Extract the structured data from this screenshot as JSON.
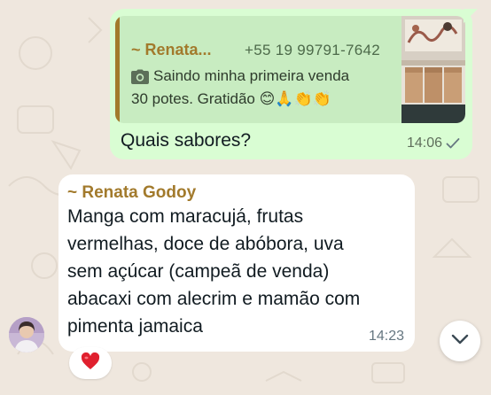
{
  "chat": {
    "outgoing": {
      "quote": {
        "sender": "~ Renata...",
        "phone": "+55 19 99791-7642",
        "line1": "Saindo minha primeira venda",
        "line2": "30 potes. Gratidão",
        "emojis": "😊🙏👏👏",
        "media_icon": "camera-icon"
      },
      "text": "Quais sabores?",
      "time": "14:06",
      "status_icon": "check-icon"
    },
    "incoming": {
      "sender": "~ Renata Godoy",
      "lines": [
        "Manga com maracujá,  frutas",
        "vermelhas, doce de abóbora, uva",
        "sem açúcar (campeã de venda)",
        "abacaxi com alecrim e mamão com",
        "pimenta jamaica"
      ],
      "time": "14:23",
      "reaction": "❤️"
    },
    "scroll_button_icon": "chevron-down-icon"
  },
  "colors": {
    "wallpaper": "#efe7de",
    "outgoing_bubble": "#d9fdd3",
    "quote_bg": "#c8ecc1",
    "sender_name": "#a27a2c",
    "incoming_bubble": "#ffffff"
  }
}
